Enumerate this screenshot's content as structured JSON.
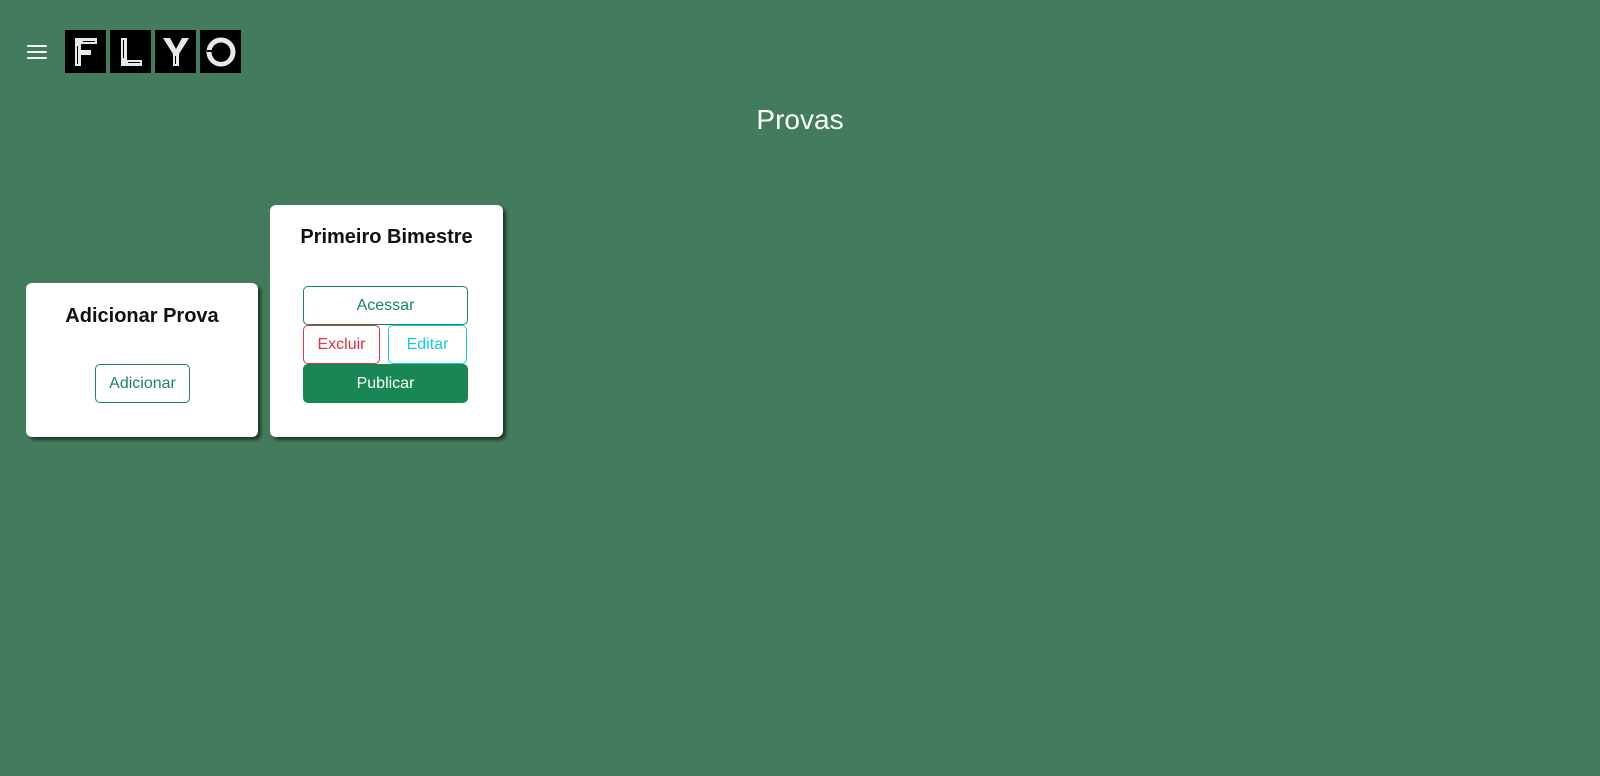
{
  "header": {
    "menu_icon": "hamburger-menu-icon",
    "logo_text": "FLYO"
  },
  "page": {
    "title": "Provas"
  },
  "add_card": {
    "title": "Adicionar Prova",
    "add_label": "Adicionar"
  },
  "exams": [
    {
      "title": "Primeiro Bimestre",
      "access_label": "Acessar",
      "delete_label": "Excluir",
      "edit_label": "Editar",
      "publish_label": "Publicar"
    }
  ],
  "colors": {
    "background": "#437c5c",
    "success": "#198754",
    "danger": "#dc3545",
    "info": "#0dcaf0"
  }
}
